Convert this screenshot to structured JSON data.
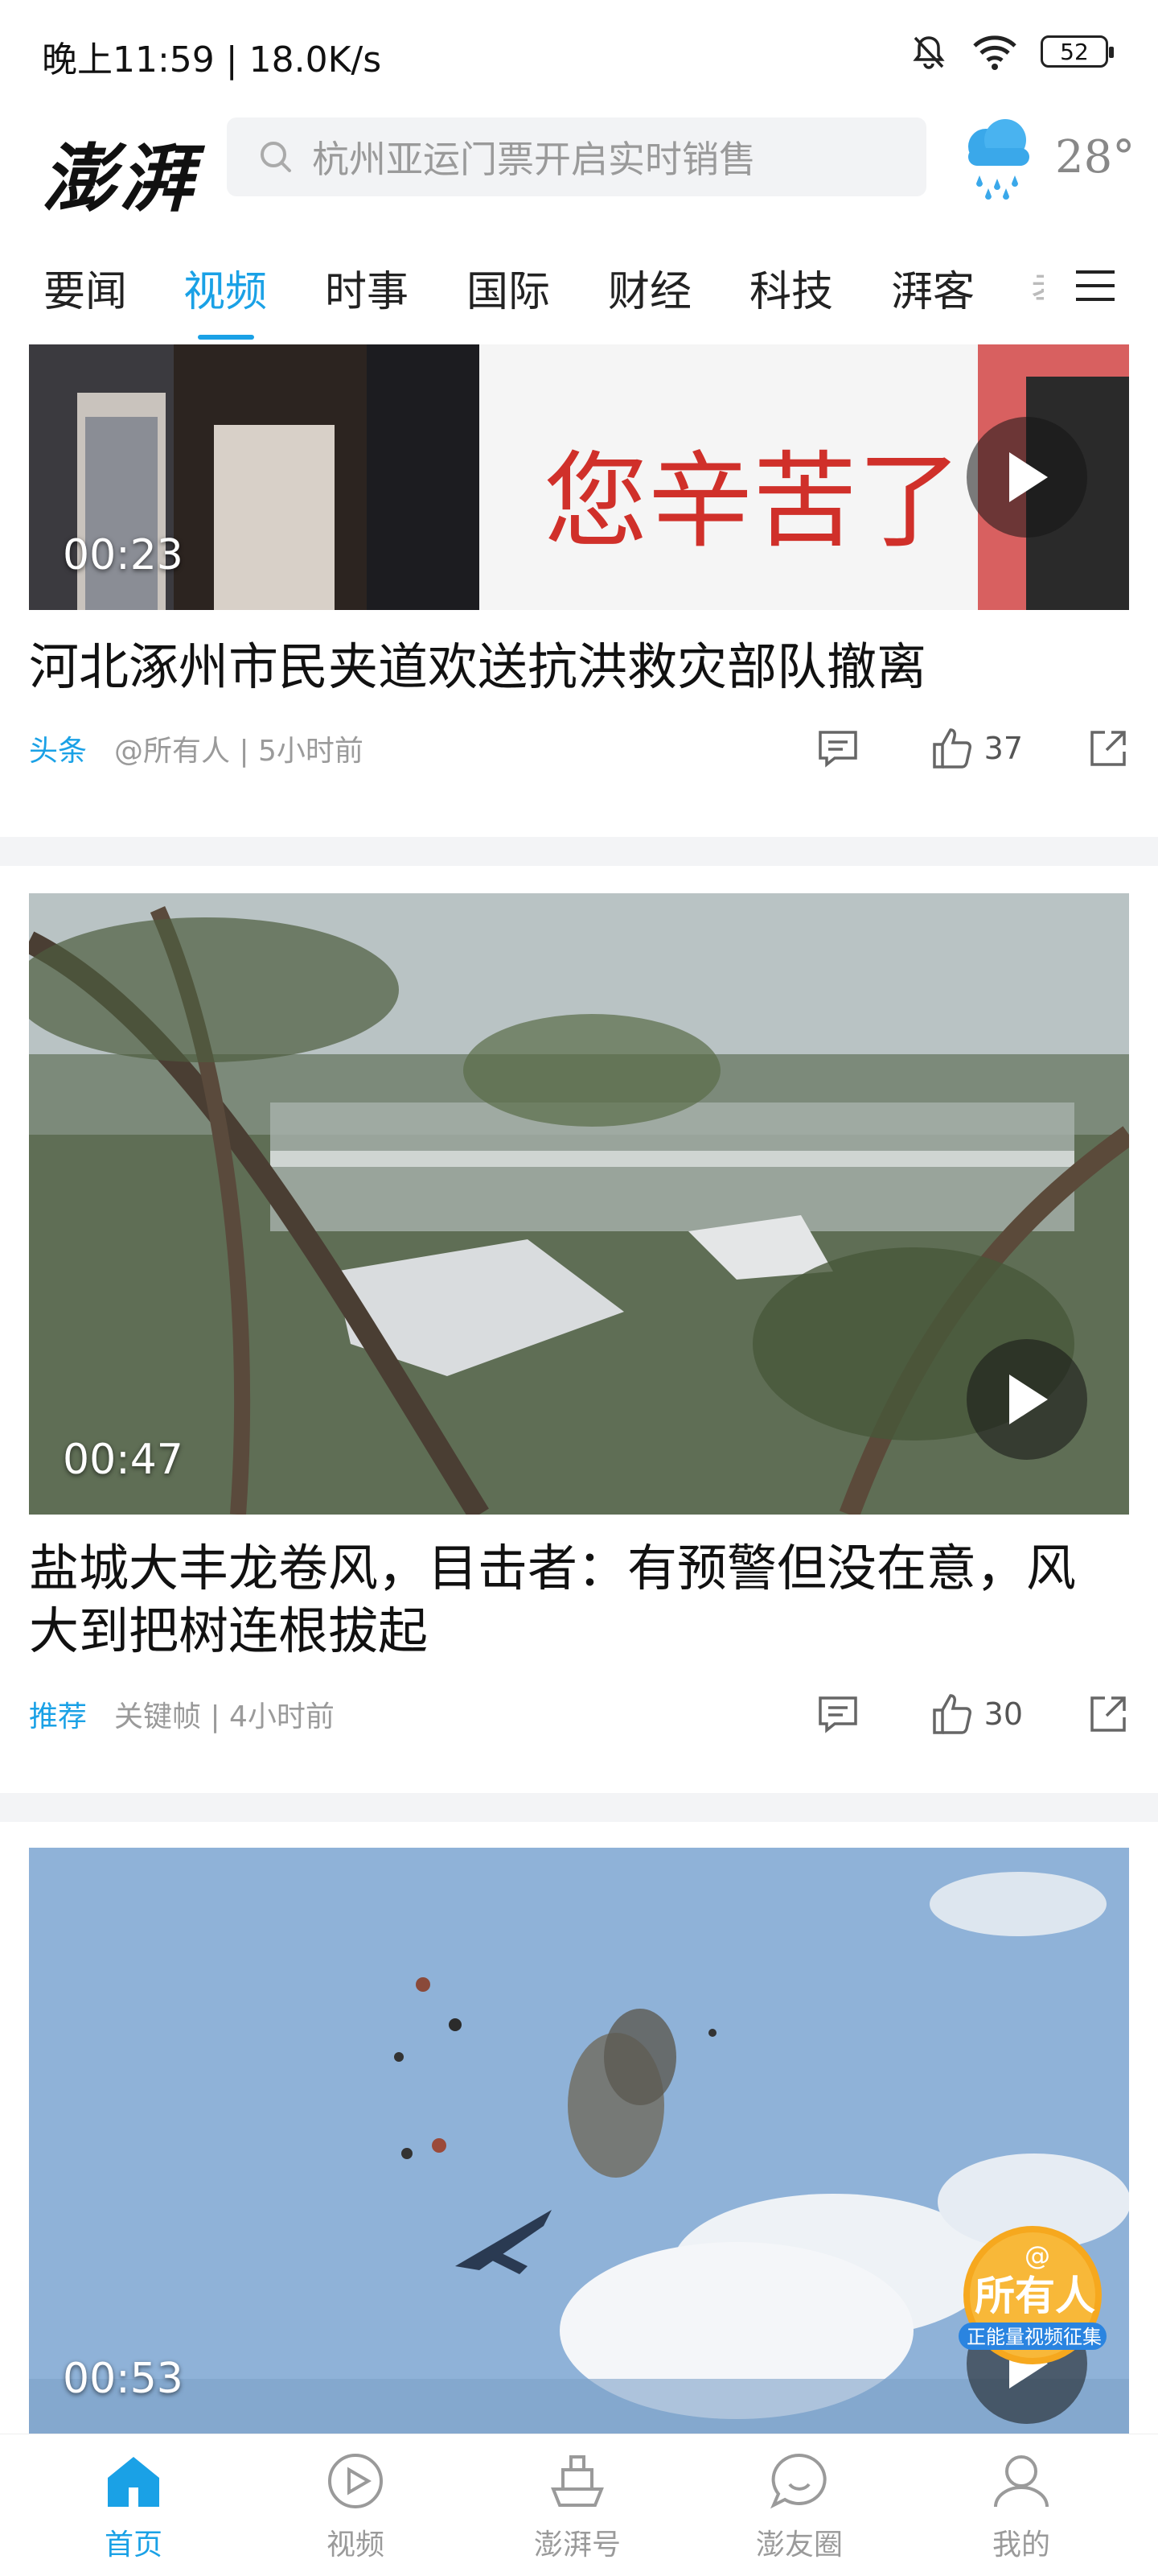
{
  "status_bar": {
    "time_speed": "晚上11:59 | 18.0K/s",
    "battery": "52"
  },
  "header": {
    "logo": "澎湃",
    "search_placeholder": "杭州亚运门票开启实时销售",
    "weather": {
      "icon": "rain-cloud-icon",
      "temp": "28°"
    }
  },
  "tabs": [
    {
      "label": "要闻"
    },
    {
      "label": "视频",
      "active": true
    },
    {
      "label": "时事"
    },
    {
      "label": "国际"
    },
    {
      "label": "财经"
    },
    {
      "label": "科技"
    },
    {
      "label": "湃客"
    },
    {
      "label": "孝"
    }
  ],
  "feed": [
    {
      "duration": "00:23",
      "title": "河北涿州市民夹道欢送抗洪救灾部队撤离",
      "tag": "头条",
      "source_time": "@所有人 | 5小时前",
      "likes": "37",
      "banner_text": "您辛苦了"
    },
    {
      "duration": "00:47",
      "title_line1": "盐城大丰龙卷风，目击者：有预警但没在意，风",
      "title_line2": "大到把树连根拔起",
      "tag": "推荐",
      "source_time": "关键帧 | 4小时前",
      "likes": "30"
    },
    {
      "duration": "00:53"
    }
  ],
  "badge": {
    "top": "@",
    "main": "所有人",
    "sub": "正能量视频征集"
  },
  "bottom_nav": [
    {
      "label": "首页",
      "active": true
    },
    {
      "label": "视频"
    },
    {
      "label": "澎湃号"
    },
    {
      "label": "澎友圈"
    },
    {
      "label": "我的"
    }
  ],
  "colors": {
    "accent": "#1aa1e6",
    "muted": "#9a9a9a"
  }
}
